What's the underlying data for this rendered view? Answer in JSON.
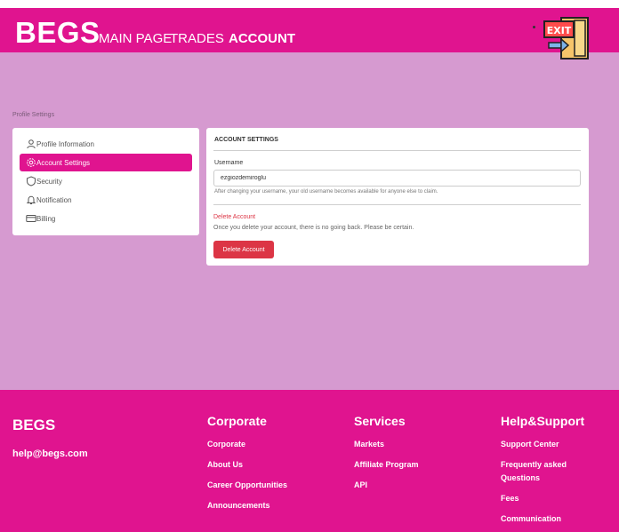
{
  "header": {
    "brand": "BEGS",
    "nav": [
      "MAIN PAGE",
      "TRADES",
      "ACCOUNT"
    ],
    "exit_sign": "EXIT",
    "exit_icon": "exit-door-icon",
    "bar_color": "#e0148f"
  },
  "breadcrumb": "Profile Settings",
  "sidebar": {
    "items": [
      {
        "label": "Profile Information",
        "icon": "user-icon"
      },
      {
        "label": "Account Settings",
        "icon": "gear-icon",
        "active": true
      },
      {
        "label": "Security",
        "icon": "shield-icon"
      },
      {
        "label": "Notification",
        "icon": "bell-icon"
      },
      {
        "label": "Billing",
        "icon": "credit-card-icon"
      }
    ]
  },
  "account": {
    "title": "ACCOUNT SETTINGS",
    "username_label": "Username",
    "username_value": "ezgiozdemiroglu",
    "username_help": "After changing your username, your old username becomes available for anyone else to claim.",
    "delete_title": "Delete Account",
    "delete_text": "Once you delete your account, there is no going back. Please be certain.",
    "delete_button": "Delete Account",
    "danger_color": "#dc3545"
  },
  "footer": {
    "brand": "BEGS",
    "email": "help@begs.com",
    "columns": [
      {
        "title": "Corporate",
        "links": [
          "Corporate",
          "About Us",
          "Career Opportunities",
          "Announcements"
        ]
      },
      {
        "title": "Services",
        "links": [
          "Markets",
          "Affiliate Program",
          "API"
        ]
      },
      {
        "title": "Help&Support",
        "links": [
          "Support Center",
          "Frequently asked Questions",
          "Fees",
          "Communication"
        ]
      }
    ]
  },
  "colors": {
    "background": "#d69ad0",
    "accent": "#e0148f"
  }
}
